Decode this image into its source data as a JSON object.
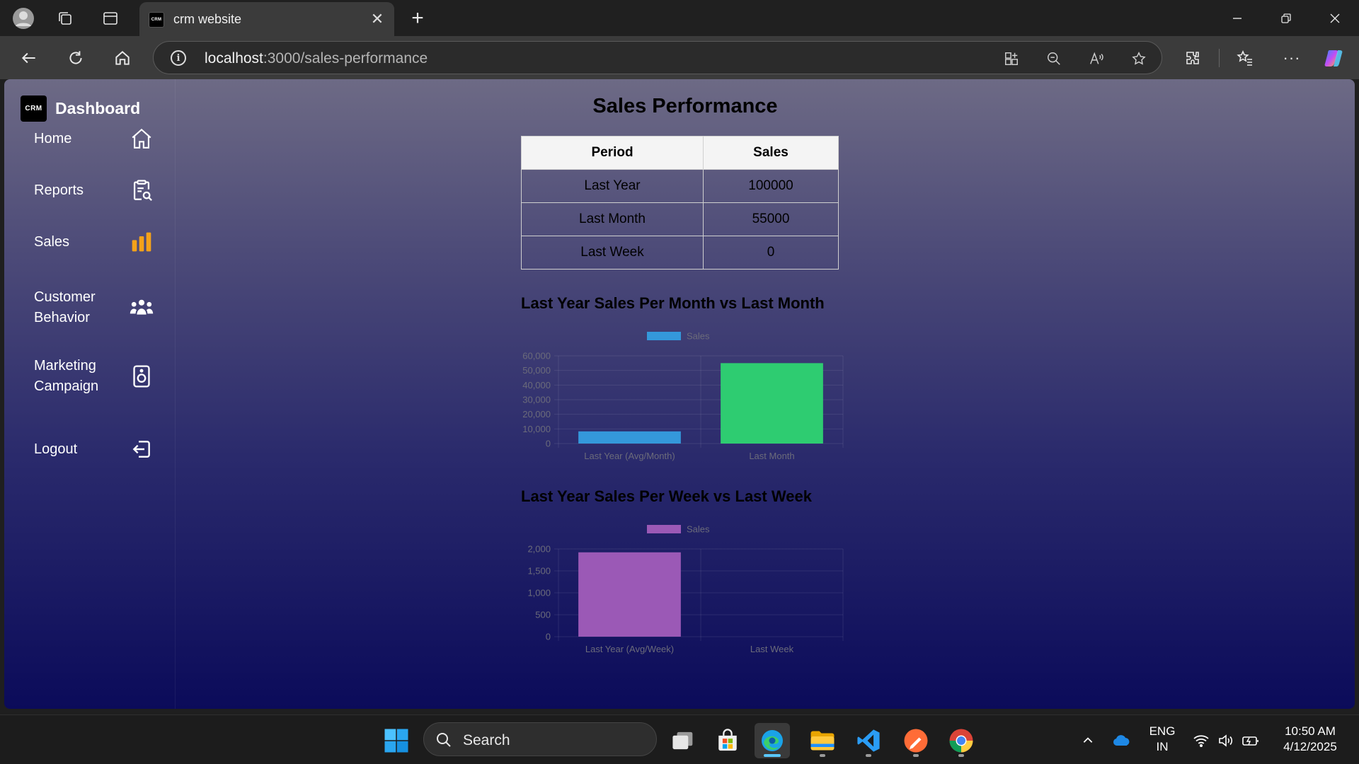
{
  "browser": {
    "tab_title": "crm website",
    "tab_favicon": "CRM",
    "url_host": "localhost",
    "url_path": ":3000/sales-performance"
  },
  "sidebar": {
    "brand_logo": "CRM",
    "brand_title": "Dashboard",
    "items": [
      {
        "label": "Home",
        "icon": "home-icon"
      },
      {
        "label": "Reports",
        "icon": "clipboard-search-icon"
      },
      {
        "label": "Sales",
        "icon": "bar-chart-icon"
      },
      {
        "label": "Customer Behavior",
        "icon": "users-group-icon"
      },
      {
        "label": "Marketing Campaign",
        "icon": "speaker-icon"
      },
      {
        "label": "Logout",
        "icon": "logout-icon"
      }
    ]
  },
  "main": {
    "title": "Sales Performance",
    "table": {
      "headers": [
        "Period",
        "Sales"
      ],
      "rows": [
        [
          "Last Year",
          "100000"
        ],
        [
          "Last Month",
          "55000"
        ],
        [
          "Last Week",
          "0"
        ]
      ]
    }
  },
  "chart_data": [
    {
      "type": "bar",
      "title": "Last Year Sales Per Month vs Last Month",
      "categories": [
        "Last Year (Avg/Month)",
        "Last Month"
      ],
      "series": [
        {
          "name": "Sales",
          "values": [
            8333,
            55000
          ]
        }
      ],
      "bar_colors": [
        "#3498db",
        "#2ecc71"
      ],
      "legend_color": "#3498db",
      "yticks": [
        "0",
        "10,000",
        "20,000",
        "30,000",
        "40,000",
        "50,000",
        "60,000"
      ],
      "ylim": [
        0,
        60000
      ],
      "grid": true,
      "legend": "top"
    },
    {
      "type": "bar",
      "title": "Last Year Sales Per Week vs Last Week",
      "categories": [
        "Last Year (Avg/Week)",
        "Last Week"
      ],
      "series": [
        {
          "name": "Sales",
          "values": [
            1923,
            0
          ]
        }
      ],
      "bar_colors": [
        "#9b59b6",
        "#9b59b6"
      ],
      "legend_color": "#9b59b6",
      "yticks": [
        "0",
        "500",
        "1,000",
        "1,500",
        "2,000"
      ],
      "ylim": [
        0,
        2000
      ],
      "grid": true,
      "legend": "top"
    }
  ],
  "taskbar": {
    "search_placeholder": "Search",
    "lang_line1": "ENG",
    "lang_line2": "IN",
    "time": "10:50 AM",
    "date": "4/12/2025"
  }
}
